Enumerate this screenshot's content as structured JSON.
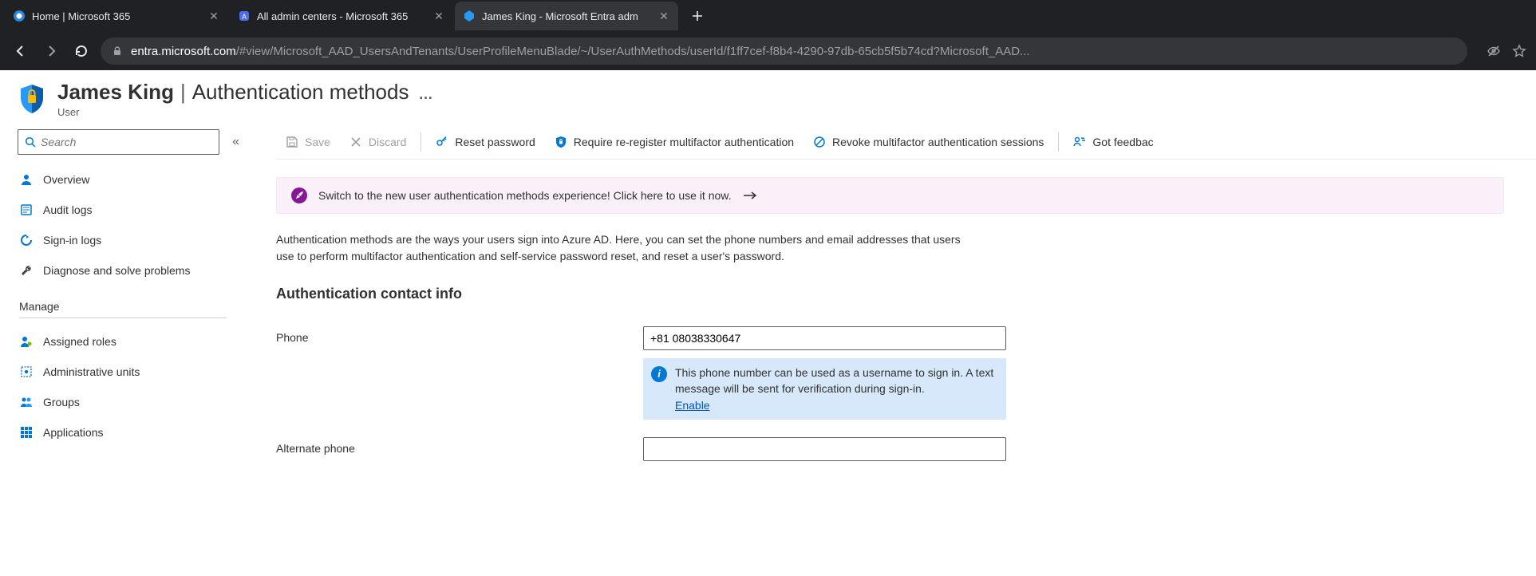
{
  "browser": {
    "tabs": [
      {
        "title": "Home | Microsoft 365",
        "active": false
      },
      {
        "title": "All admin centers - Microsoft 365",
        "active": false
      },
      {
        "title": "James King - Microsoft Entra adm",
        "active": true
      }
    ],
    "url_domain": "entra.microsoft.com",
    "url_path": "/#view/Microsoft_AAD_UsersAndTenants/UserProfileMenuBlade/~/UserAuthMethods/userId/f1ff7cef-f8b4-4290-97db-65cb5f5b74cd?Microsoft_AAD..."
  },
  "header": {
    "user_name": "James King",
    "section": "Authentication methods",
    "subtitle": "User"
  },
  "sidebar": {
    "search_placeholder": "Search",
    "items": {
      "overview": "Overview",
      "audit": "Audit logs",
      "signin": "Sign-in logs",
      "diagnose": "Diagnose and solve problems"
    },
    "group_manage": "Manage",
    "manage_items": {
      "roles": "Assigned roles",
      "units": "Administrative units",
      "groups": "Groups",
      "apps": "Applications"
    }
  },
  "commands": {
    "save": "Save",
    "discard": "Discard",
    "reset": "Reset password",
    "rereg": "Require re-register multifactor authentication",
    "revoke": "Revoke multifactor authentication sessions",
    "feedback": "Got feedbac"
  },
  "banner": {
    "text": "Switch to the new user authentication methods experience! Click here to use it now."
  },
  "main": {
    "description": "Authentication methods are the ways your users sign into Azure AD. Here, you can set the phone numbers and email addresses that users use to perform multifactor authentication and self-service password reset, and reset a user's password.",
    "section_title": "Authentication contact info",
    "phone_label": "Phone",
    "phone_value": "+81 08038330647",
    "phone_info_text": "This phone number can be used as a username to sign in. A text message will be sent for verification during sign-in.",
    "phone_info_link": "Enable",
    "alt_phone_label": "Alternate phone",
    "alt_phone_value": ""
  }
}
